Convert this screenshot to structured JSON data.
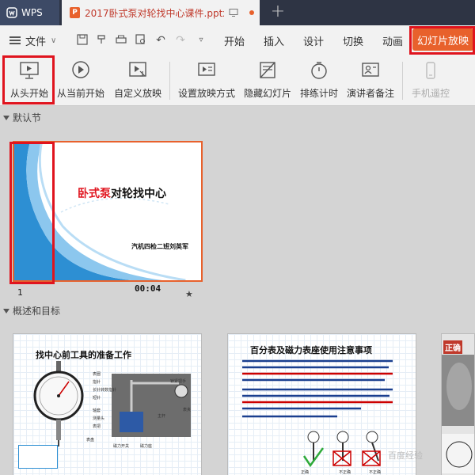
{
  "tabbar": {
    "app_name": "WPS",
    "doc_title": "2017卧式泵对轮找中心课件.pptx",
    "new_tab": "+"
  },
  "menubar": {
    "file": "文件",
    "tabs": [
      "开始",
      "插入",
      "设计",
      "切换",
      "动画"
    ],
    "active_tab": "幻灯片放映",
    "accent_color": "#e8612c",
    "highlight_color": "#e0141e"
  },
  "ribbon": {
    "buttons": [
      {
        "label": "从头开始",
        "icon": "play-from-start-icon"
      },
      {
        "label": "从当前开始",
        "icon": "play-from-current-icon"
      },
      {
        "label": "自定义放映",
        "icon": "custom-show-icon"
      },
      {
        "label": "设置放映方式",
        "icon": "slideshow-settings-icon"
      },
      {
        "label": "隐藏幻灯片",
        "icon": "hide-slide-icon"
      },
      {
        "label": "排练计时",
        "icon": "rehearse-timing-icon"
      },
      {
        "label": "演讲者备注",
        "icon": "speaker-notes-icon"
      },
      {
        "label": "手机遥控",
        "icon": "phone-remote-icon"
      }
    ]
  },
  "sections": {
    "default": "默认节",
    "overview": "概述和目标"
  },
  "slides": [
    {
      "number": "1",
      "time": "00:04",
      "star": "★",
      "title_red": "卧式泵",
      "title_rest": "对轮找中心",
      "subtitle": "汽机四检二班刘英军"
    },
    {
      "title": "找中心前工具的准备工作",
      "labels": [
        "表圈",
        "指针",
        "长针转数指针",
        "短针",
        "轴套",
        "测量头",
        "表把",
        "表盘",
        "主杆",
        "锁紧把手",
        "表夹",
        "磁力开关",
        "磁力座"
      ]
    },
    {
      "title": "百分表及磁力表座使用注意事项",
      "marks": [
        "正确",
        "不正确",
        "不正确"
      ]
    },
    {
      "title": "正确"
    }
  ],
  "watermark": "百度经验"
}
